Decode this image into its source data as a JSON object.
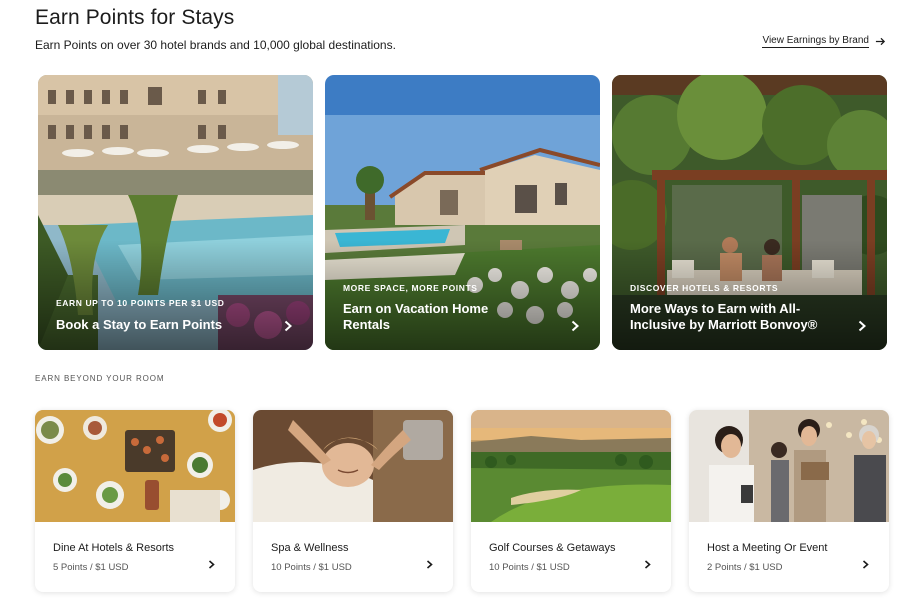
{
  "header": {
    "title": "Earn Points for Stays",
    "subtitle": "Earn Points on over 30 hotel brands and 10,000 global destinations.",
    "view_link": "View Earnings by Brand"
  },
  "heroes": [
    {
      "eyebrow": "EARN UP TO 10 POINTS PER $1 USD",
      "heading": "Book a Stay to Earn Points",
      "image": "resort-pool-image"
    },
    {
      "eyebrow": "MORE SPACE, MORE POINTS",
      "heading": "Earn on Vacation Home Rentals",
      "image": "villa-pool-image"
    },
    {
      "eyebrow": "DISCOVER HOTELS & RESORTS",
      "heading": "More Ways to Earn with All-Inclusive by Marriott Bonvoy®",
      "image": "pergola-couple-image"
    }
  ],
  "section_label": "EARN BEYOND YOUR ROOM",
  "earn_cards": [
    {
      "name": "Dine At Hotels & Resorts",
      "rate": "5 Points / $1 USD",
      "image": "dining-table-image"
    },
    {
      "name": "Spa & Wellness",
      "rate": "10 Points / $1 USD",
      "image": "spa-massage-image"
    },
    {
      "name": "Golf Courses & Getaways",
      "rate": "10 Points / $1 USD",
      "image": "golf-course-image"
    },
    {
      "name": "Host a Meeting Or Event",
      "rate": "2 Points / $1 USD",
      "image": "meeting-event-image"
    }
  ],
  "icons": {
    "arrow": "arrow-right-icon",
    "chevron": "chevron-right-icon"
  }
}
